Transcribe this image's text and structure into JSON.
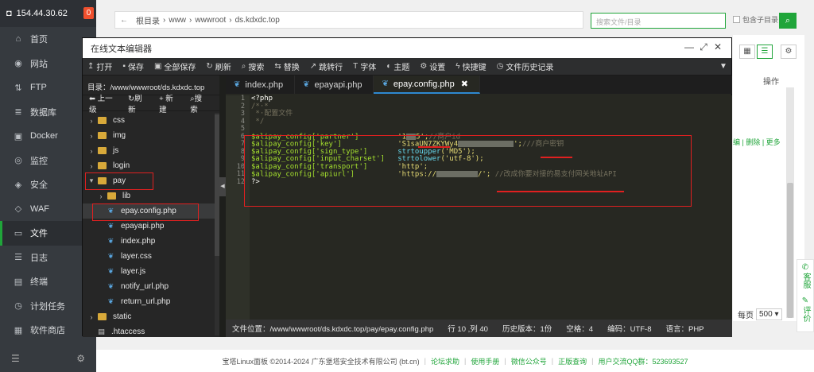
{
  "sidebar": {
    "ip": "154.44.30.62",
    "badge": "0",
    "items": [
      {
        "label": "首页",
        "icon": "home-icon",
        "glyph": "⌂"
      },
      {
        "label": "网站",
        "icon": "globe-icon",
        "glyph": "◉"
      },
      {
        "label": "FTP",
        "icon": "ftp-icon",
        "glyph": "⇅"
      },
      {
        "label": "数据库",
        "icon": "database-icon",
        "glyph": "≣"
      },
      {
        "label": "Docker",
        "icon": "docker-icon",
        "glyph": "▣"
      },
      {
        "label": "监控",
        "icon": "monitor-icon",
        "glyph": "◎"
      },
      {
        "label": "安全",
        "icon": "shield-icon",
        "glyph": "◈"
      },
      {
        "label": "WAF",
        "icon": "waf-icon",
        "glyph": "◇"
      },
      {
        "label": "文件",
        "icon": "folder-icon",
        "glyph": "▭"
      },
      {
        "label": "日志",
        "icon": "log-icon",
        "glyph": "☰"
      },
      {
        "label": "终端",
        "icon": "terminal-icon",
        "glyph": "▤"
      },
      {
        "label": "计划任务",
        "icon": "clock-icon",
        "glyph": "◷"
      },
      {
        "label": "软件商店",
        "icon": "store-icon",
        "glyph": "▦"
      }
    ],
    "active_index": 8
  },
  "filemanager": {
    "breadcrumbs": [
      "根目录",
      "www",
      "wwwroot",
      "ds.kdxdc.top"
    ],
    "search_placeholder": "搜索文件/目录",
    "include_subdir": "包含子目录",
    "ops_header": "操作",
    "row_ops": "编 | 删除 | 更多",
    "per_page_label": "每页",
    "per_page_value": "500",
    "side_tools": [
      "客服",
      "评价"
    ]
  },
  "editor": {
    "title": "在线文本编辑器",
    "toolbar": [
      {
        "label": "打开",
        "icon": "open-icon",
        "glyph": "↥"
      },
      {
        "label": "保存",
        "icon": "save-icon",
        "glyph": "▪"
      },
      {
        "label": "全部保存",
        "icon": "save-all-icon",
        "glyph": "▣"
      },
      {
        "label": "刷新",
        "icon": "refresh-icon",
        "glyph": "↻"
      },
      {
        "label": "搜索",
        "icon": "search-icon",
        "glyph": "⌕"
      },
      {
        "label": "替换",
        "icon": "replace-icon",
        "glyph": "⇆"
      },
      {
        "label": "跳转行",
        "icon": "jump-icon",
        "glyph": "↗"
      },
      {
        "label": "字体",
        "icon": "font-icon",
        "glyph": "T"
      },
      {
        "label": "主题",
        "icon": "theme-icon",
        "glyph": "◐"
      },
      {
        "label": "设置",
        "icon": "gear-icon",
        "glyph": "⚙"
      },
      {
        "label": "快捷键",
        "icon": "lightning-icon",
        "glyph": "ϟ"
      },
      {
        "label": "文件历史记录",
        "icon": "history-icon",
        "glyph": "◷"
      }
    ],
    "dir_label": "目录：/www/wwwroot/ds.kdxdc.top",
    "side_actions": [
      "上一级",
      "刷新",
      "新建",
      "搜索"
    ],
    "tree": [
      {
        "name": "css",
        "type": "folder",
        "level": 0,
        "open": false
      },
      {
        "name": "img",
        "type": "folder",
        "level": 0,
        "open": false
      },
      {
        "name": "js",
        "type": "folder",
        "level": 0,
        "open": false
      },
      {
        "name": "login",
        "type": "folder",
        "level": 0,
        "open": false
      },
      {
        "name": "pay",
        "type": "folder",
        "level": 0,
        "open": true
      },
      {
        "name": "lib",
        "type": "folder",
        "level": 1,
        "open": false
      },
      {
        "name": "epay.config.php",
        "type": "php",
        "level": 1,
        "selected": true
      },
      {
        "name": "epayapi.php",
        "type": "php",
        "level": 1
      },
      {
        "name": "index.php",
        "type": "php",
        "level": 1
      },
      {
        "name": "layer.css",
        "type": "css",
        "level": 1
      },
      {
        "name": "layer.js",
        "type": "js",
        "level": 1
      },
      {
        "name": "notify_url.php",
        "type": "php",
        "level": 1
      },
      {
        "name": "return_url.php",
        "type": "php",
        "level": 1
      },
      {
        "name": "static",
        "type": "folder",
        "level": 0,
        "open": false
      },
      {
        "name": ".htaccess",
        "type": "file",
        "level": 0
      }
    ],
    "tabs": [
      {
        "label": "index.php",
        "active": false
      },
      {
        "label": "epayapi.php",
        "active": false
      },
      {
        "label": "epay.config.php",
        "active": true
      }
    ],
    "code": {
      "l1": "<?php",
      "l2": "/*·*",
      "l3": " *·配置文件",
      "l4": " */",
      "l6_var": "$alipay_config['partner']",
      "l6_val": "'1",
      "l6_val_end": "5';",
      "l6_cmt": "//商户id",
      "l7_var": "$alipay_config['key']",
      "l7_val": "'S1saUN7ZKYWy4",
      "l7_val_end": "';",
      "l7_cmt": "///商户密钥",
      "l8_var": "$alipay_config['sign_type']",
      "l8_fn": "strtoupper",
      "l8_val": "('MD5');",
      "l9_var": "$alipay_config['input_charset']",
      "l9_fn": "strtolower",
      "l9_val": "('utf-8');",
      "l10_var": "$alipay_config['transport']",
      "l10_val": "'http';",
      "l11_var": "$alipay_config['apiurl']",
      "l11_val": "'https://",
      "l11_val_end": "/';",
      "l11_cmt": "//改成你要对接的易支付网关地址API",
      "l12": "?>"
    },
    "status": {
      "path": "文件位置：/www/wwwroot/ds.kdxdc.top/pay/epay.config.php",
      "pos": "行 10 ,列 40",
      "history": "历史版本：1份",
      "indent": "空格：4",
      "encoding": "编码：UTF-8",
      "lang": "语言：PHP"
    }
  },
  "footer": {
    "copyright": "宝塔Linux面板 ©2014-2024 广东堡塔安全技术有限公司 (bt.cn)",
    "links": [
      "论坛求助",
      "使用手册",
      "微信公众号",
      "正版查询",
      "用户交流QQ群：523693527"
    ]
  },
  "colors": {
    "brand_green": "#20a53a",
    "annotation_red": "#e02020",
    "editor_bg": "#272822"
  }
}
